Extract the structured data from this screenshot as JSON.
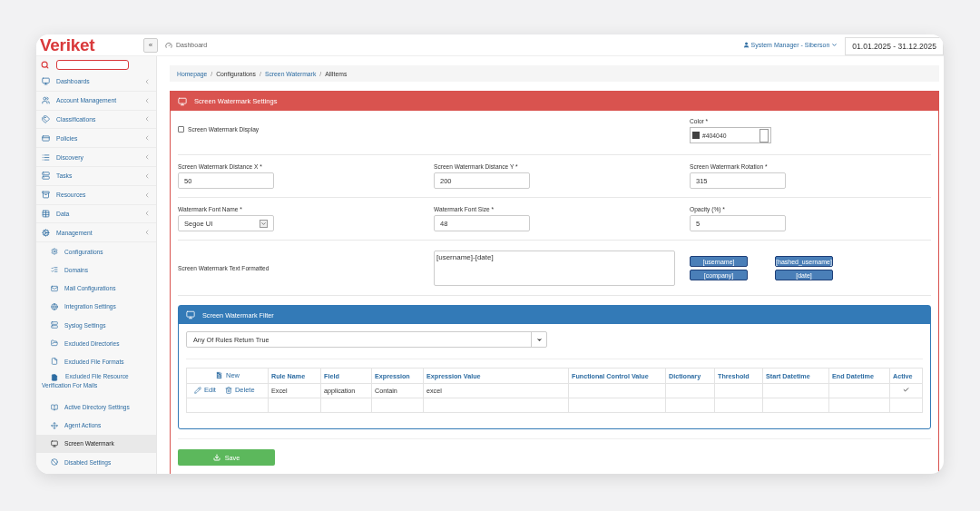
{
  "header": {
    "logo": "Veriket",
    "collapse": "«",
    "page": "Dashboard",
    "user": "System Manager - Siberson",
    "date_range": "01.01.2025 - 31.12.2025"
  },
  "sidebar": {
    "items": [
      {
        "label": "Dashboards",
        "selected": false
      },
      {
        "label": "Account Management",
        "selected": false
      },
      {
        "label": "Classifications",
        "selected": false
      },
      {
        "label": "Policies",
        "selected": false
      },
      {
        "label": "Discovery",
        "selected": false
      },
      {
        "label": "Tasks",
        "selected": false
      },
      {
        "label": "Resources",
        "selected": false
      },
      {
        "label": "Data",
        "selected": false
      },
      {
        "label": "Management",
        "selected": false,
        "children": [
          {
            "label": "Configurations",
            "selected": false
          },
          {
            "label": "Domains",
            "selected": false
          },
          {
            "label": "Mail Configurations",
            "selected": false
          },
          {
            "label": "Integration Settings",
            "selected": false
          },
          {
            "label": "Syslog Settings",
            "selected": false
          },
          {
            "label": "Excluded Directories",
            "selected": false
          },
          {
            "label": "Excluded File Formats",
            "selected": false
          },
          {
            "label": "Excluded File Resource Verification For Mails",
            "selected": false
          },
          {
            "label": "Active Directory Settings",
            "selected": false
          },
          {
            "label": "Agent Actions",
            "selected": false
          },
          {
            "label": "Screen Watermark",
            "selected": true
          },
          {
            "label": "Disabled Settings",
            "selected": false
          }
        ]
      }
    ]
  },
  "breadcrumb_separator": "/",
  "breadcrumb": [
    {
      "label": "Homepage",
      "link": true
    },
    {
      "label": "Configurations",
      "link": false
    },
    {
      "label": "Screen Watermark",
      "link": true
    },
    {
      "label": "AllItems",
      "link": false
    }
  ],
  "settings": {
    "title": "Screen Watermark Settings",
    "display": {
      "label": "Screen Watermark Display",
      "checked": false
    },
    "color": {
      "label": "Color",
      "required": "*",
      "value": "#404040"
    },
    "rows": [
      [
        {
          "label": "Screen Watermark Distance X",
          "required": "*",
          "value": "50",
          "kind": "text"
        },
        {
          "label": "Screen Watermark Distance Y",
          "required": "*",
          "value": "200",
          "kind": "text"
        },
        {
          "label": "Screen Watermark Rotation",
          "required": "*",
          "value": "315",
          "kind": "text"
        }
      ],
      [
        {
          "label": "Watermark Font Name",
          "required": "*",
          "value": "Segoe UI",
          "kind": "select"
        },
        {
          "label": "Watermark Font Size",
          "required": "*",
          "value": "48",
          "kind": "text"
        },
        {
          "label": "Opacity (%)",
          "required": "*",
          "value": "5",
          "kind": "text"
        }
      ]
    ],
    "text_formatted": {
      "label": "Screen Watermark Text Formatted",
      "value": "[username]-[date]",
      "tokens": [
        "[username]",
        "[hashed_username]",
        "[company]",
        "[date]"
      ]
    },
    "filter": {
      "title": "Screen Watermark Filter",
      "mode": "Any Of Rules Return True",
      "new": "New",
      "edit": "Edit",
      "delete": "Delete",
      "columns": [
        "Rule Name",
        "Field",
        "Expression",
        "Expression Value",
        "Functional Control Value",
        "Dictionary",
        "Threshold",
        "Start Datetime",
        "End Datetime",
        "Active"
      ],
      "rows": [
        {
          "cells": [
            "Excel",
            "application",
            "Contain",
            "excel",
            "",
            "",
            "",
            "",
            ""
          ],
          "active": true
        }
      ]
    },
    "save": "Save"
  }
}
